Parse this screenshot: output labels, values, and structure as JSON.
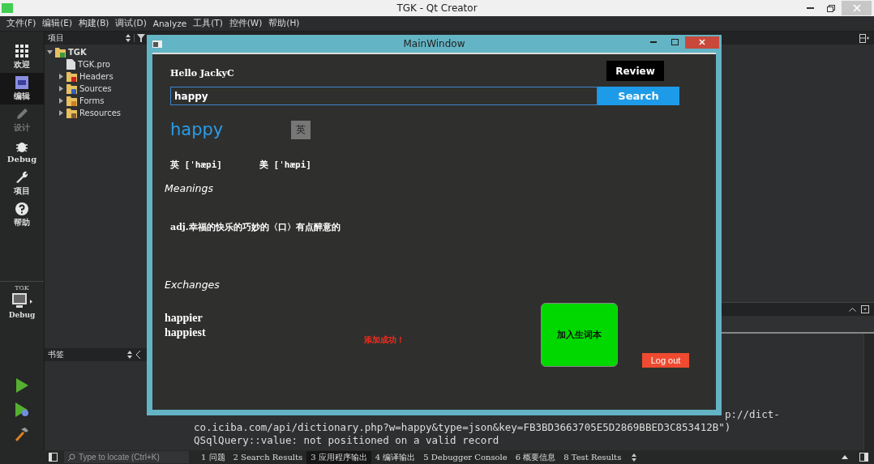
{
  "window": {
    "title": "TGK - Qt Creator"
  },
  "menu": [
    "文件(F)",
    "编辑(E)",
    "构建(B)",
    "调试(D)",
    "Analyze",
    "工具(T)",
    "控件(W)",
    "帮助(H)"
  ],
  "modes": [
    {
      "kind": "welcome",
      "label": "欢迎",
      "selected": false,
      "disabled": false
    },
    {
      "kind": "edit",
      "label": "编辑",
      "selected": true,
      "disabled": false
    },
    {
      "kind": "design",
      "label": "设计",
      "selected": false,
      "disabled": true
    },
    {
      "kind": "debug",
      "label": "Debug",
      "selected": false,
      "disabled": false
    },
    {
      "kind": "projects",
      "label": "项目",
      "selected": false,
      "disabled": false
    },
    {
      "kind": "help",
      "label": "帮助",
      "selected": false,
      "disabled": false
    }
  ],
  "kit": {
    "project": "TGK",
    "config": "Debug"
  },
  "project_pane": {
    "title": "项目",
    "tree": [
      {
        "kind": "project",
        "label": "TGK",
        "expanded": true,
        "children": [
          {
            "kind": "file",
            "label": "TGK.pro"
          },
          {
            "kind": "headers",
            "label": "Headers",
            "expanded": false
          },
          {
            "kind": "sources",
            "label": "Sources",
            "expanded": false
          },
          {
            "kind": "forms",
            "label": "Forms",
            "expanded": false
          },
          {
            "kind": "resources",
            "label": "Resources",
            "expanded": false
          }
        ]
      }
    ]
  },
  "bookmarks_pane": {
    "title": "书签"
  },
  "output": {
    "lines": [
      "p://dict-",
      "co.iciba.com/api/dictionary.php?w=happy&type=json&key=FB3BD3663705E5D2869BBED3C853412B\")",
      "QSqlQuery::value: not positioned on a valid record"
    ]
  },
  "locator": {
    "placeholder": "Type to locate (Ctrl+K)"
  },
  "output_tabs": [
    {
      "label": "1 问题",
      "selected": false
    },
    {
      "label": "2 Search Results",
      "selected": false
    },
    {
      "label": "3 应用程序输出",
      "selected": true
    },
    {
      "label": "4 编译输出",
      "selected": false
    },
    {
      "label": "5 Debugger Console",
      "selected": false
    },
    {
      "label": "6 概要信息",
      "selected": false
    },
    {
      "label": "8 Test Results",
      "selected": false
    }
  ],
  "app": {
    "title": "MainWindow",
    "greeting": "Hello JackyC",
    "review_button": "Review",
    "search": {
      "value": "happy"
    },
    "search_button": "Search",
    "word": "happy",
    "lang_button": "英",
    "phonetics": [
      "英 [ˈhæpi]",
      "美 [ˈhæpi]"
    ],
    "meanings_title": "Meanings",
    "meanings": [
      "adj.幸福的快乐的巧妙的〈口〉有点醉意的"
    ],
    "exchanges_title": "Exchanges",
    "exchanges": [
      "happier",
      "happiest"
    ],
    "message": "添加成功！",
    "add_button": "加入生词本",
    "logout_button": "Log out"
  }
}
